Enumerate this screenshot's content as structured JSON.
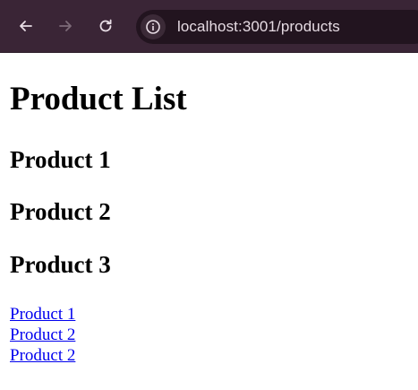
{
  "browser": {
    "url": "localhost:3001/products"
  },
  "page": {
    "title": "Product List",
    "products": [
      {
        "heading": "Product 1"
      },
      {
        "heading": "Product 2"
      },
      {
        "heading": "Product 3"
      }
    ],
    "links": [
      {
        "label": "Product 1"
      },
      {
        "label": "Product 2"
      },
      {
        "label": "Product 2"
      }
    ]
  },
  "colors": {
    "toolbar": "#3a2536",
    "omnibox": "#22141f",
    "link": "#0000ee"
  },
  "icons": {
    "back": "arrow-left",
    "forward": "arrow-right",
    "reload": "reload",
    "site_info": "info-circle"
  }
}
